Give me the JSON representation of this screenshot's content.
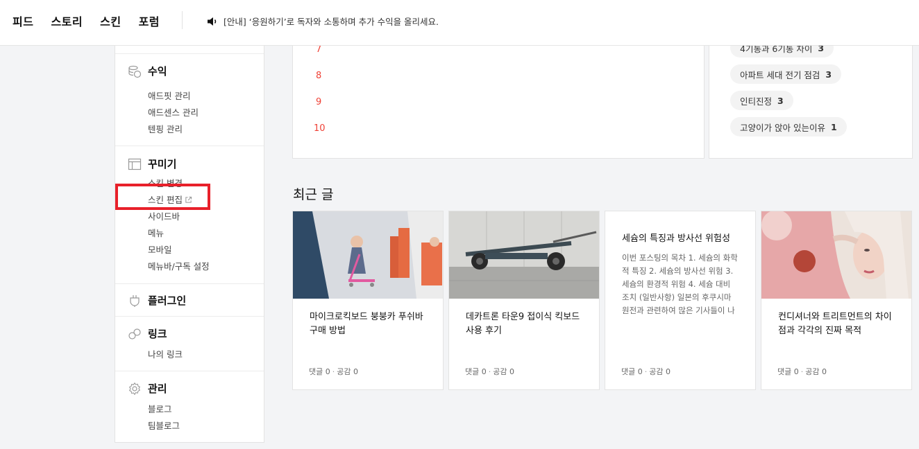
{
  "topnav": {
    "items": [
      "피드",
      "스토리",
      "스킨",
      "포럼"
    ],
    "notice": "[안내] ‘응원하기’로 독자와 소통하며 추가 수익을 올리세요."
  },
  "sidebar": {
    "revenue": {
      "title": "수익",
      "items": [
        "애드핏 관리",
        "애드센스 관리",
        "텐핑 관리"
      ]
    },
    "decorate": {
      "title": "꾸미기",
      "items": [
        "스킨 변경",
        "스킨 편집",
        "사이드바",
        "메뉴",
        "모바일",
        "메뉴바/구독 설정"
      ]
    },
    "plugin": {
      "title": "플러그인"
    },
    "link": {
      "title": "링크",
      "items": [
        "나의 링크"
      ]
    },
    "manage": {
      "title": "관리",
      "items": [
        "블로그",
        "팀블로그"
      ]
    }
  },
  "popular": {
    "ranks": [
      "7",
      "8",
      "9",
      "10"
    ]
  },
  "keywords": [
    {
      "label": "4기통과 6기통 차이",
      "count": "3"
    },
    {
      "label": "아파트 세대 전기 점검",
      "count": "3"
    },
    {
      "label": "인티진정",
      "count": "3"
    },
    {
      "label": "고양이가 앉아 있는이유",
      "count": "1"
    }
  ],
  "recent": {
    "title": "최근 글",
    "meta": {
      "comments": "댓글 0",
      "likes": "공감 0"
    },
    "posts": [
      {
        "title": "마이크로킥보드 붕붕카 푸쉬바 구매 방법"
      },
      {
        "title": "데카트론 타운9 접이식 킥보드 사용 후기"
      },
      {
        "title": "세슘의 특징과 방사선 위험성",
        "excerpt": "이번 포스팅의 목차 1. 세슘의 화학적 특징 2. 세슘의 방사선 위험 3. 세슘의 환경적 위험 4. 세슘 대비 조치 (일반사항) 일본의 후쿠시마 원전과 관련하여 많은 기사들이 나오고 …"
      },
      {
        "title": "컨디셔너와 트리트먼트의 차이점과 각각의 진짜 목적"
      }
    ]
  }
}
